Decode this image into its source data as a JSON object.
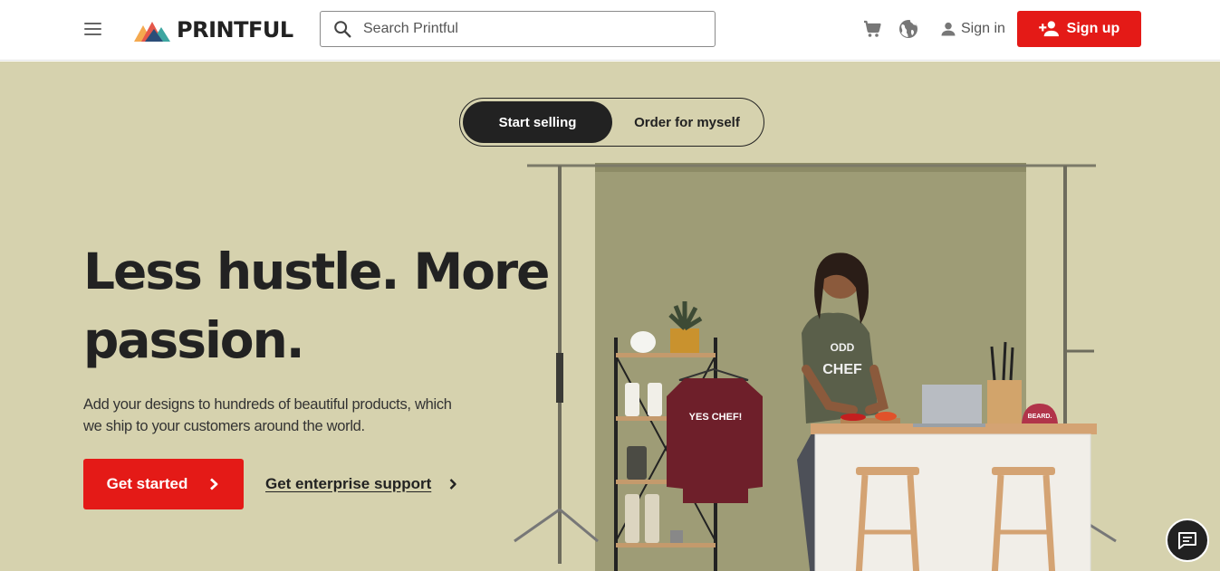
{
  "header": {
    "logo_text": "PRINTFUL",
    "search": {
      "placeholder": "Search Printful",
      "value": ""
    },
    "icons": [
      "menu-icon",
      "cart-icon",
      "globe-icon",
      "user-icon",
      "add-user-icon"
    ],
    "sign_in_label": "Sign in",
    "sign_up_label": "Sign up"
  },
  "hero": {
    "toggle": {
      "options": [
        "Start selling",
        "Order for myself"
      ],
      "selected": "Start selling"
    },
    "headline_line1": "Less hustle. More",
    "headline_line2": "passion.",
    "sub_line1": "Add your designs to hundreds of beautiful products, which",
    "sub_line2": "we ship to your customers around the world.",
    "cta_label": "Get started",
    "enterprise_label": "Get enterprise support",
    "image": {
      "sweatshirt_text": "YES CHEF!",
      "tshirt_text_1": "ODD",
      "tshirt_text_2": "CHEF",
      "cap_text": "BEARD."
    }
  },
  "colors": {
    "brand_red": "#e41a17",
    "hero_bg": "#d6d2ae",
    "backdrop": "#9e9c76",
    "dark": "#222222"
  }
}
